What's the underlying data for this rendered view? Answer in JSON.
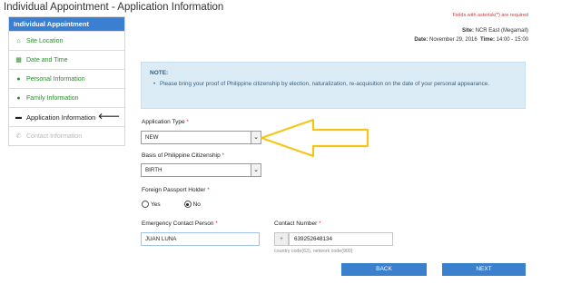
{
  "page": {
    "title": "Individual Appointment - Application Information"
  },
  "sidebar": {
    "header": "Individual Appointment",
    "items": [
      {
        "label": "Site Location",
        "icon": "home-icon",
        "glyph": "⌂"
      },
      {
        "label": "Date and Time",
        "icon": "calendar-icon",
        "glyph": "▦"
      },
      {
        "label": "Personal Information",
        "icon": "user-icon",
        "glyph": "●"
      },
      {
        "label": "Family Information",
        "icon": "users-icon",
        "glyph": "●"
      },
      {
        "label": "Application Information",
        "icon": "id-card-icon",
        "glyph": "▬"
      },
      {
        "label": "Contact Information",
        "icon": "phone-icon",
        "glyph": "✆"
      }
    ],
    "active_arrow": "🡐"
  },
  "header": {
    "required_note": "Fields with asterisk(*) are required",
    "site_label": "Site:",
    "site_value": "NCR East (Megamall)",
    "date_label": "Date:",
    "date_value": "November 29, 2016",
    "time_label": "Time:",
    "time_value": "14:00 - 15:00"
  },
  "note": {
    "title": "NOTE:",
    "text": "Please bring your proof of Philippine citizenship by election, naturalization, re-acquisition on the date of your personal appearance."
  },
  "form": {
    "application_type": {
      "label": "Application Type",
      "req": "*",
      "value": "NEW"
    },
    "citizenship": {
      "label": "Basis of Philippine Citizenship",
      "req": "*",
      "value": "BIRTH"
    },
    "foreign_passport": {
      "label": "Foreign Passport Holder",
      "req": "*",
      "options": [
        "Yes",
        "No"
      ],
      "selected": "No"
    },
    "emergency_contact": {
      "label": "Emergency Contact Person",
      "req": "*",
      "value": "JUAN LUNA"
    },
    "contact_number": {
      "label": "Contact Number",
      "req": "*",
      "prefix": "+",
      "value": "639252648134",
      "hint": "country code(63), network code(900)"
    }
  },
  "buttons": {
    "back": "BACK",
    "next": "NEXT"
  },
  "colors": {
    "primary": "#3b80cc",
    "note_bg": "#dcecf6",
    "required": "#dd3333",
    "sidebar_icon": "#2e8b2e",
    "annotation": "#f5c518"
  }
}
